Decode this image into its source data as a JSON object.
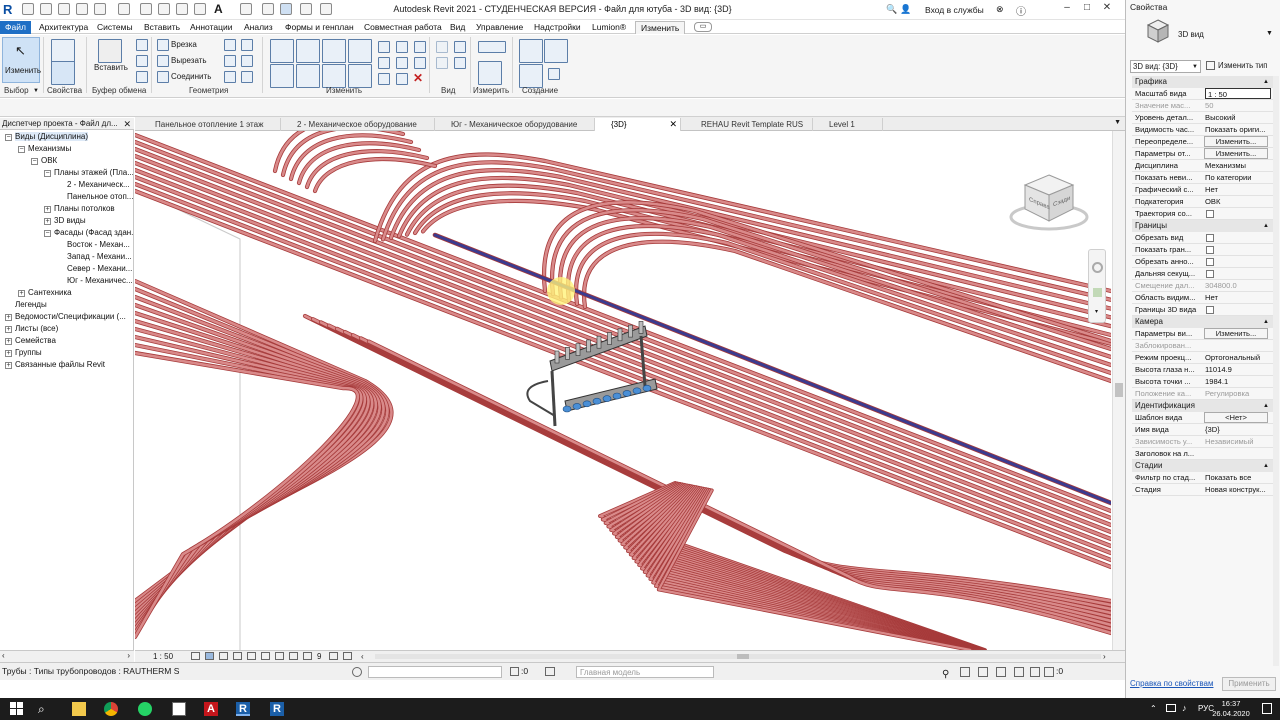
{
  "window": {
    "title": "Autodesk Revit 2021 - СТУДЕНЧЕСКАЯ ВЕРСИЯ - Файл для ютуба - 3D вид: {3D}",
    "signin_label": "Вход в службы",
    "controls": {
      "minimize": "–",
      "maximize": "□",
      "close": "✕"
    }
  },
  "ribbon_tabs": [
    "Файл",
    "Архитектура",
    "Системы",
    "Вставить",
    "Аннотации",
    "Анализ",
    "Формы и генплан",
    "Совместная работа",
    "Вид",
    "Управление",
    "Надстройки",
    "Lumion®",
    "Изменить"
  ],
  "ribbon": {
    "select": {
      "modify_label": "Изменить",
      "panel": "Выбор"
    },
    "properties": {
      "panel": "Свойства"
    },
    "clipboard": {
      "paste_label": "Вставить",
      "panel": "Буфер обмена"
    },
    "geometry": {
      "cut": "Врезка",
      "trim": "Вырезать",
      "join": "Соединить",
      "panel": "Геометрия"
    },
    "modify": {
      "panel": "Изменить"
    },
    "view": {
      "panel": "Вид"
    },
    "measure": {
      "panel": "Измерить"
    },
    "create": {
      "panel": "Создание"
    }
  },
  "project_browser": {
    "header": "Диспетчер проекта - Файл дл...",
    "items": [
      {
        "label": "Виды (Дисциплина)",
        "toggle": "−"
      },
      {
        "label": "Механизмы",
        "toggle": "−"
      },
      {
        "label": "ОВК",
        "toggle": "−"
      },
      {
        "label": "Планы этажей (Пла...",
        "toggle": "−"
      },
      {
        "label": "2 - Механическ...",
        "toggle": ""
      },
      {
        "label": "Панельное отоп...",
        "toggle": ""
      },
      {
        "label": "Планы потолков",
        "toggle": "+"
      },
      {
        "label": "3D виды",
        "toggle": "+"
      },
      {
        "label": "Фасады (Фасад здан...",
        "toggle": "−"
      },
      {
        "label": "Восток - Механ...",
        "toggle": ""
      },
      {
        "label": "Запад - Механи...",
        "toggle": ""
      },
      {
        "label": "Север - Механи...",
        "toggle": ""
      },
      {
        "label": "Юг - Механичес...",
        "toggle": ""
      },
      {
        "label": "Сантехника",
        "toggle": "+"
      },
      {
        "label": "Легенды",
        "toggle": ""
      },
      {
        "label": "Ведомости/Спецификации (...",
        "toggle": "+"
      },
      {
        "label": "Листы (все)",
        "toggle": "+"
      },
      {
        "label": "Семейства",
        "toggle": "+"
      },
      {
        "label": "Группы",
        "toggle": "+"
      },
      {
        "label": "Связанные файлы Revit",
        "toggle": "+"
      }
    ]
  },
  "view_tabs": [
    {
      "label": "Панельное отопление 1 этаж",
      "active": false
    },
    {
      "label": "2 - Механическое оборудование",
      "active": false
    },
    {
      "label": "Юг - Механическое оборудование",
      "active": false
    },
    {
      "label": "{3D}",
      "active": true
    },
    {
      "label": "REHAU Revit Template RUS",
      "active": false
    },
    {
      "label": "Level 1",
      "active": false
    }
  ],
  "viewcube": {
    "left_face": "Справа",
    "right_face": "Сзади"
  },
  "view_control": {
    "scale": "1 : 50",
    "count": "9"
  },
  "status": {
    "message": "Трубы : Типы трубопроводов : RAUTHERM S",
    "zero1": ":0",
    "model": "Главная модель",
    "zero2": ":0"
  },
  "properties": {
    "header": "Свойства",
    "type_name": "3D вид",
    "selector": "3D вид: {3D}",
    "edit_type": "Изменить тип",
    "groups": [
      {
        "name": "Графика",
        "rows": [
          {
            "k": "Масштаб вида",
            "v": "1 : 50",
            "kind": "input"
          },
          {
            "k": "Значение мас...",
            "v": "50",
            "kind": "dim"
          },
          {
            "k": "Уровень детал...",
            "v": "Высокий"
          },
          {
            "k": "Видимость час...",
            "v": "Показать ориги..."
          },
          {
            "k": "Переопределе...",
            "v": "Изменить...",
            "kind": "button"
          },
          {
            "k": "Параметры от...",
            "v": "Изменить...",
            "kind": "button"
          },
          {
            "k": "Дисциплина",
            "v": "Механизмы"
          },
          {
            "k": "Показать неви...",
            "v": "По категории"
          },
          {
            "k": "Графический с...",
            "v": "Нет"
          },
          {
            "k": "Подкатегория",
            "v": "ОВК"
          },
          {
            "k": "Траектория со...",
            "v": "",
            "kind": "check"
          }
        ]
      },
      {
        "name": "Границы",
        "rows": [
          {
            "k": "Обрезать вид",
            "v": "",
            "kind": "check"
          },
          {
            "k": "Показать гран...",
            "v": "",
            "kind": "check"
          },
          {
            "k": "Обрезать анно...",
            "v": "",
            "kind": "check"
          },
          {
            "k": "Дальняя секущ...",
            "v": "",
            "kind": "check"
          },
          {
            "k": "Смещение дал...",
            "v": "304800.0",
            "kind": "dim"
          },
          {
            "k": "Область видим...",
            "v": "Нет"
          },
          {
            "k": "Границы 3D вида",
            "v": "",
            "kind": "check"
          }
        ]
      },
      {
        "name": "Камера",
        "rows": [
          {
            "k": "Параметры ви...",
            "v": "Изменить...",
            "kind": "button"
          },
          {
            "k": "Заблокирован...",
            "v": "",
            "kind": "dim"
          },
          {
            "k": "Режим проекц...",
            "v": "Ортогональный"
          },
          {
            "k": "Высота глаза н...",
            "v": "11014.9"
          },
          {
            "k": "Высота точки ...",
            "v": "1984.1"
          },
          {
            "k": "Положение ка...",
            "v": "Регулировка",
            "kind": "dim"
          }
        ]
      },
      {
        "name": "Идентификация",
        "rows": [
          {
            "k": "Шаблон вида",
            "v": "<Нет>",
            "kind": "button"
          },
          {
            "k": "Имя вида",
            "v": "{3D}"
          },
          {
            "k": "Зависимость у...",
            "v": "Независимый",
            "kind": "dim"
          },
          {
            "k": "Заголовок на л...",
            "v": ""
          }
        ]
      },
      {
        "name": "Стадии",
        "rows": [
          {
            "k": "Фильтр по стад...",
            "v": "Показать все"
          },
          {
            "k": "Стадия",
            "v": "Новая конструк..."
          }
        ]
      }
    ],
    "help_link": "Справка по свойствам",
    "apply": "Применить"
  },
  "taskbar": {
    "lang": "РУС",
    "time": "16:37",
    "date": "26.04.2020"
  },
  "colors": {
    "pipe": "#d98a8a",
    "pipe_outline": "#a63a3a",
    "supply_pipe": "#3b3b8f",
    "file_tab": "#1f6fc5"
  }
}
